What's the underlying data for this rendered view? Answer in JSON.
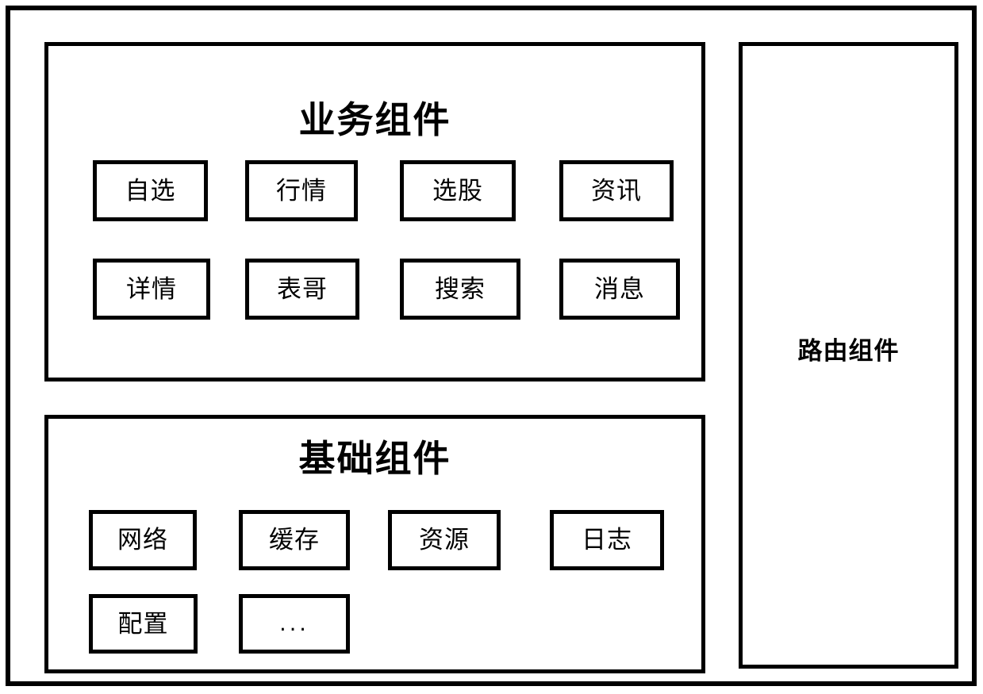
{
  "diagram": {
    "type": "architecture-block-diagram",
    "background_color": "#FFFFFF",
    "line_color": "#000000",
    "panels": {
      "business": {
        "title": "业务组件",
        "rows": [
          [
            {
              "label": "自选"
            },
            {
              "label": "行情"
            },
            {
              "label": "选股"
            },
            {
              "label": "资讯"
            }
          ],
          [
            {
              "label": "详情"
            },
            {
              "label": "表哥"
            },
            {
              "label": "搜索"
            },
            {
              "label": "消息"
            }
          ]
        ]
      },
      "basic": {
        "title": "基础组件",
        "rows": [
          [
            {
              "label": "网络"
            },
            {
              "label": "缓存"
            },
            {
              "label": "资源"
            },
            {
              "label": "日志"
            }
          ],
          [
            {
              "label": "配置"
            },
            {
              "label": "..."
            }
          ]
        ]
      },
      "router": {
        "title": "路由组件"
      }
    }
  }
}
